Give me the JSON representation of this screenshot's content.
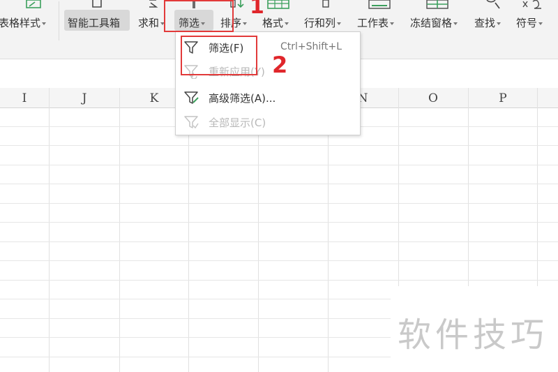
{
  "ribbon": {
    "table_style": "表格样式",
    "smart_toolbox": "智能工具箱",
    "sum": "求和",
    "filter": "筛选",
    "sort": "排序",
    "format": "格式",
    "row_col": "行和列",
    "worksheet": "工作表",
    "freeze": "冻结窗格",
    "find": "查找",
    "symbol": "符号"
  },
  "columns": [
    "I",
    "J",
    "K",
    "N",
    "O",
    "P"
  ],
  "menu": {
    "items": [
      {
        "label": "筛选(F)",
        "shortcut": "Ctrl+Shift+L",
        "icon": "filter-icon",
        "enabled": true
      },
      {
        "label": "重新应用(Y)",
        "icon": "reapply-filter-icon",
        "enabled": false
      },
      {
        "label": "高级筛选(A)...",
        "icon": "advanced-filter-icon",
        "enabled": true
      },
      {
        "label": "全部显示(C)",
        "icon": "show-all-icon",
        "enabled": false
      }
    ]
  },
  "annotations": {
    "step1": "1",
    "step2": "2"
  },
  "watermark": "软件技巧",
  "colors": {
    "annotation_red": "#e23a3a",
    "ribbon_bg": "#f3f3f3",
    "active_button_bg": "#d8d8d8"
  }
}
